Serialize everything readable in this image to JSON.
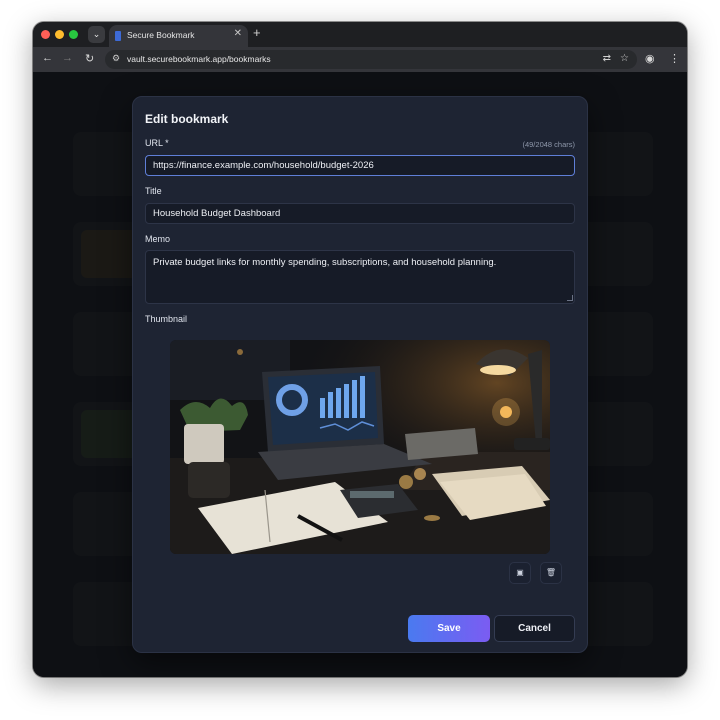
{
  "browser": {
    "tab_title": "Secure Bookmark",
    "url": "vault.securebookmark.app/bookmarks"
  },
  "modal": {
    "title": "Edit bookmark",
    "url_label": "URL *",
    "url_char_count": "(49/2048 chars)",
    "url_value": "https://finance.example.com/household/budget-2026",
    "title_label": "Title",
    "title_value": "Household Budget Dashboard",
    "memo_label": "Memo",
    "memo_value": "Private budget links for monthly spending, subscriptions, and household planning.",
    "thumbnail_label": "Thumbnail",
    "save_label": "Save",
    "cancel_label": "Cancel"
  },
  "icons": {
    "tab_favicon": "bookmark-icon",
    "change_image": "image-icon",
    "delete_image": "trash-icon"
  },
  "colors": {
    "accent_start": "#4a7af0",
    "accent_end": "#7b5cf2",
    "modal_bg": "#1e2433",
    "input_focus": "#5f7fd8"
  }
}
